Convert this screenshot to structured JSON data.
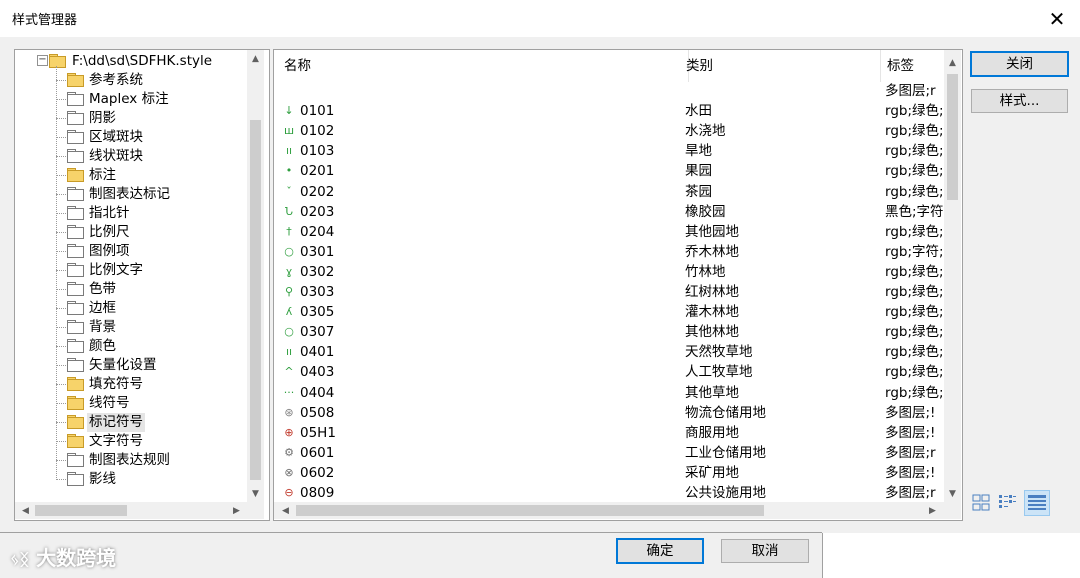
{
  "window": {
    "title": "样式管理器"
  },
  "tree": {
    "root": "F:\\dd\\sd\\SDFHK.style",
    "items": [
      {
        "label": "参考系统",
        "folder": "yellow"
      },
      {
        "label": "Maplex 标注",
        "folder": "white"
      },
      {
        "label": "阴影",
        "folder": "white"
      },
      {
        "label": "区域斑块",
        "folder": "white"
      },
      {
        "label": "线状斑块",
        "folder": "white"
      },
      {
        "label": "标注",
        "folder": "yellow"
      },
      {
        "label": "制图表达标记",
        "folder": "white"
      },
      {
        "label": "指北针",
        "folder": "white"
      },
      {
        "label": "比例尺",
        "folder": "white"
      },
      {
        "label": "图例项",
        "folder": "white"
      },
      {
        "label": "比例文字",
        "folder": "white"
      },
      {
        "label": "色带",
        "folder": "white"
      },
      {
        "label": "边框",
        "folder": "white"
      },
      {
        "label": "背景",
        "folder": "white"
      },
      {
        "label": "颜色",
        "folder": "white"
      },
      {
        "label": "矢量化设置",
        "folder": "white"
      },
      {
        "label": "填充符号",
        "folder": "yellow"
      },
      {
        "label": "线符号",
        "folder": "yellow"
      },
      {
        "label": "标记符号",
        "folder": "yellow-open",
        "selected": true
      },
      {
        "label": "文字符号",
        "folder": "yellow"
      },
      {
        "label": "制图表达规则",
        "folder": "white"
      },
      {
        "label": "影线",
        "folder": "white"
      }
    ]
  },
  "list": {
    "columns": [
      "名称",
      "类别",
      "标签"
    ],
    "rows": [
      {
        "icon": "",
        "name": "",
        "category": "",
        "tags": "多图层;r"
      },
      {
        "icon": "↓",
        "icon_color": "#2e9e3e",
        "name": "0101",
        "category": "水田",
        "tags": "rgb;绿色;"
      },
      {
        "icon": "ш",
        "icon_color": "#2e9e3e",
        "name": "0102",
        "category": "水浇地",
        "tags": "rgb;绿色;"
      },
      {
        "icon": "ıı",
        "icon_color": "#2e9e3e",
        "name": "0103",
        "category": "旱地",
        "tags": "rgb;绿色;"
      },
      {
        "icon": "•",
        "icon_color": "#2e9e3e",
        "name": "0201",
        "category": "果园",
        "tags": "rgb;绿色;"
      },
      {
        "icon": "ˇ",
        "icon_color": "#2e9e3e",
        "name": "0202",
        "category": "茶园",
        "tags": "rgb;绿色;"
      },
      {
        "icon": "Ն",
        "icon_color": "#2e9e3e",
        "name": "0203",
        "category": "橡胶园",
        "tags": "黑色;字符"
      },
      {
        "icon": "†",
        "icon_color": "#2e9e3e",
        "name": "0204",
        "category": "其他园地",
        "tags": "rgb;绿色;"
      },
      {
        "icon": "○",
        "icon_color": "#2e9e3e",
        "name": "0301",
        "category": "乔木林地",
        "tags": "rgb;字符;"
      },
      {
        "icon": "ɣ",
        "icon_color": "#2e9e3e",
        "name": "0302",
        "category": "竹林地",
        "tags": "rgb;绿色;"
      },
      {
        "icon": "⚲",
        "icon_color": "#2e9e3e",
        "name": "0303",
        "category": "红树林地",
        "tags": "rgb;绿色;"
      },
      {
        "icon": "ʎ",
        "icon_color": "#2e9e3e",
        "name": "0305",
        "category": "灌木林地",
        "tags": "rgb;绿色;"
      },
      {
        "icon": "○",
        "icon_color": "#2e9e3e",
        "name": "0307",
        "category": "其他林地",
        "tags": "rgb;绿色;"
      },
      {
        "icon": "ıı",
        "icon_color": "#2e9e3e",
        "name": "0401",
        "category": "天然牧草地",
        "tags": "rgb;绿色;"
      },
      {
        "icon": "^",
        "icon_color": "#2e9e3e",
        "name": "0403",
        "category": "人工牧草地",
        "tags": "rgb;绿色;"
      },
      {
        "icon": "···",
        "icon_color": "#2e9e3e",
        "name": "0404",
        "category": "其他草地",
        "tags": "rgb;绿色;"
      },
      {
        "icon": "⊛",
        "icon_color": "#808080",
        "name": "0508",
        "category": "物流仓储用地",
        "tags": "多图层;!"
      },
      {
        "icon": "⊕",
        "icon_color": "#c0392b",
        "name": "05H1",
        "category": "商服用地",
        "tags": "多图层;!"
      },
      {
        "icon": "⚙",
        "icon_color": "#707070",
        "name": "0601",
        "category": "工业仓储用地",
        "tags": "多图层;r"
      },
      {
        "icon": "⊗",
        "icon_color": "#707070",
        "name": "0602",
        "category": "采矿用地",
        "tags": "多图层;!"
      },
      {
        "icon": "⊖",
        "icon_color": "#c0392b",
        "name": "0809",
        "category": "公共设施用地",
        "tags": "多图层;r"
      }
    ]
  },
  "buttons": {
    "close": "关闭",
    "style": "样式...",
    "ok": "确定",
    "cancel": "取消"
  },
  "watermark": "大数跨境"
}
